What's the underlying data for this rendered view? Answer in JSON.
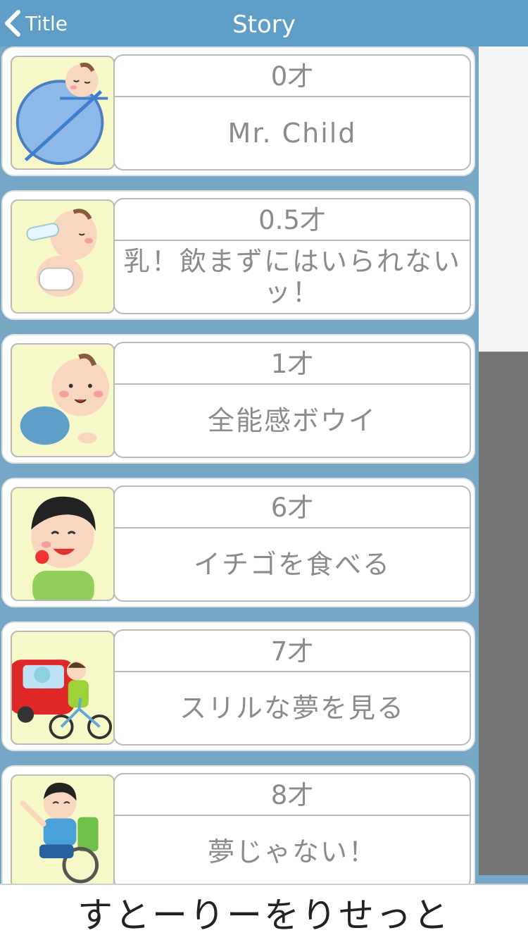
{
  "nav": {
    "back_label": "Title",
    "title": "Story"
  },
  "stories": [
    {
      "age": "0才",
      "desc": "Mr. Child",
      "illustration": "sleeping-baby"
    },
    {
      "age": "0.5才",
      "desc": "乳！飲まずにはいられないッ！",
      "illustration": "baby-bottle"
    },
    {
      "age": "1才",
      "desc": "全能感ボウイ",
      "illustration": "crawling-baby"
    },
    {
      "age": "6才",
      "desc": "イチゴを食べる",
      "illustration": "boy-strawberry"
    },
    {
      "age": "7才",
      "desc": "スリルな夢を見る",
      "illustration": "bike-car"
    },
    {
      "age": "8才",
      "desc": "夢じゃない！",
      "illustration": "wheelchair-boy"
    }
  ],
  "footer": {
    "reset_label": "すとーりーをりせっと"
  }
}
